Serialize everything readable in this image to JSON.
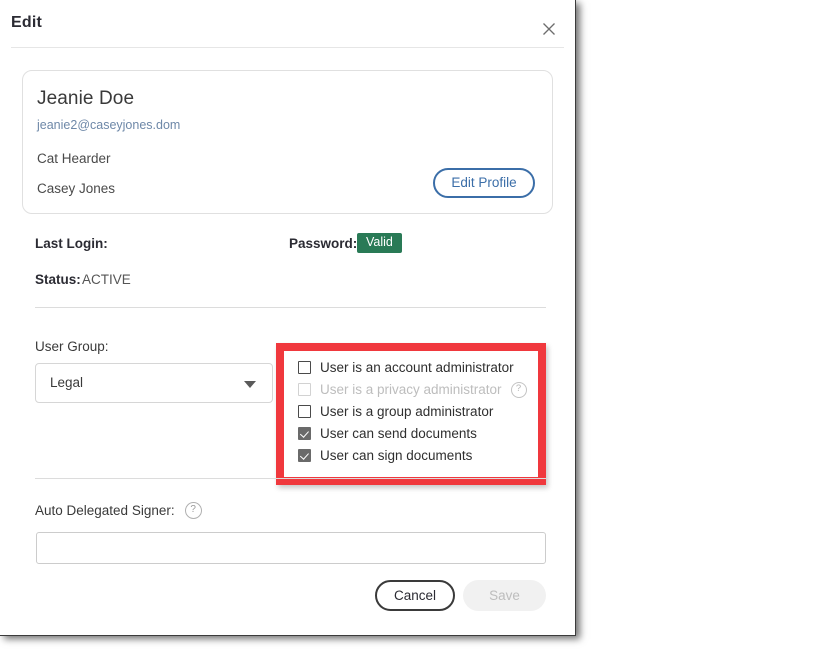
{
  "dialog": {
    "title": "Edit",
    "close_icon": "close-icon"
  },
  "profile": {
    "name": "Jeanie Doe",
    "email": "jeanie2@caseyjones.dom",
    "role": "Cat Hearder",
    "company": "Casey Jones",
    "edit_profile_label": "Edit Profile"
  },
  "meta": {
    "last_login_label": "Last Login:",
    "last_login_value": "",
    "password_label": "Password:",
    "password_badge": "Valid",
    "password_badge_color": "#297a56",
    "status_label": "Status:",
    "status_value": "ACTIVE"
  },
  "user_group": {
    "label": "User Group:",
    "selected": "Legal",
    "caret_icon": "chevron-down-icon"
  },
  "permissions": {
    "highlight_color": "#f0383d",
    "items": [
      {
        "label": "User is an account administrator",
        "checked": false,
        "disabled": false,
        "help": false
      },
      {
        "label": "User is a privacy administrator",
        "checked": false,
        "disabled": true,
        "help": true,
        "help_icon": "help-circle-icon"
      },
      {
        "label": "User is a group administrator",
        "checked": false,
        "disabled": false,
        "help": false
      },
      {
        "label": "User can send documents",
        "checked": true,
        "disabled": false,
        "help": false
      },
      {
        "label": "User can sign documents",
        "checked": true,
        "disabled": false,
        "help": false
      }
    ]
  },
  "auto_delegated_signer": {
    "label": "Auto Delegated Signer:",
    "help_icon": "help-circle-icon",
    "value": "",
    "placeholder": ""
  },
  "footer": {
    "cancel_label": "Cancel",
    "save_label": "Save"
  }
}
